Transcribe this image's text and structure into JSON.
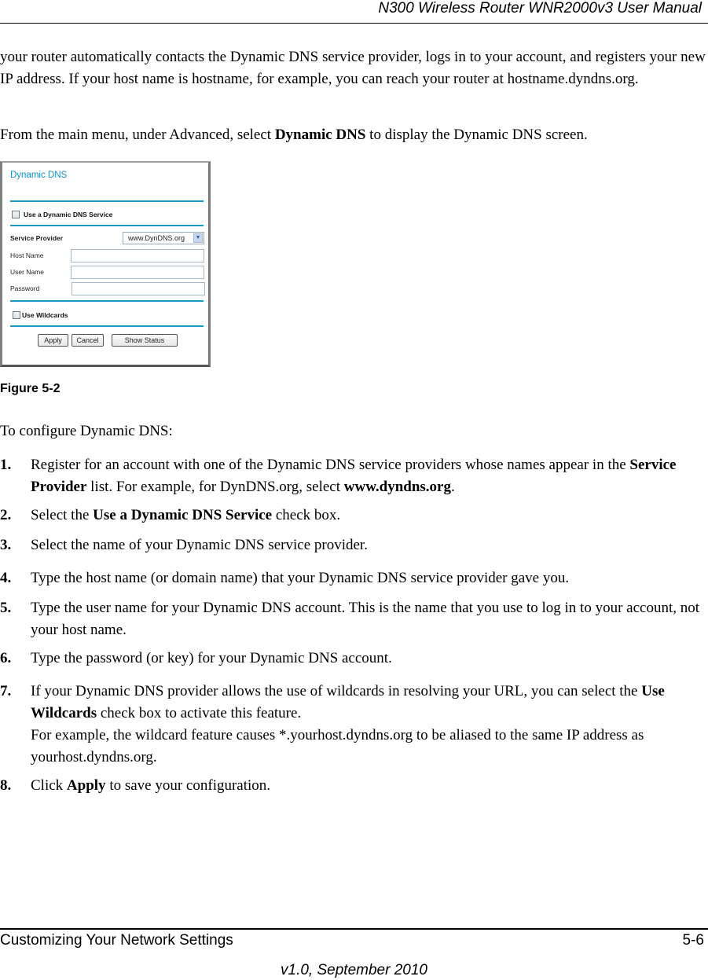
{
  "header": {
    "title": "N300 Wireless Router WNR2000v3 User Manual"
  },
  "body": {
    "paragraph1": "your router automatically contacts the Dynamic DNS service provider, logs in to your account, and registers your new IP address. If your host name is hostname, for example, you can reach your router at hostname.dyndns.org.",
    "paragraph2_pre": "From the main menu, under Advanced, select ",
    "paragraph2_bold": "Dynamic DNS",
    "paragraph2_post": " to display the Dynamic DNS screen.",
    "intro": "To configure Dynamic DNS:"
  },
  "figure": {
    "caption": "Figure 5-2",
    "screen": {
      "title": "Dynamic DNS",
      "use_ddns_label": "Use a Dynamic DNS Service",
      "use_ddns_checked": false,
      "service_provider_label": "Service Provider",
      "service_provider_value": "www.DynDNS.org",
      "host_name_label": "Host Name",
      "host_name_value": "",
      "user_name_label": "User Name",
      "user_name_value": "",
      "password_label": "Password",
      "password_value": "",
      "use_wildcards_label": "Use Wildcards",
      "use_wildcards_checked": false,
      "apply_label": "Apply",
      "cancel_label": "Cancel",
      "show_status_label": "Show Status"
    }
  },
  "steps": [
    {
      "num": "1.",
      "parts": [
        "Register for an account with one of the Dynamic DNS service providers whose names appear in the ",
        "Service Provider",
        " list. For example, for DynDNS.org, select ",
        "www.dyndns.org",
        "."
      ]
    },
    {
      "num": "2.",
      "parts": [
        "Select the ",
        "Use a Dynamic DNS Service",
        " check box."
      ]
    },
    {
      "num": "3.",
      "parts": [
        "Select the name of your Dynamic DNS service provider."
      ]
    },
    {
      "num": "4.",
      "parts": [
        "Type the host name (or domain name) that your Dynamic DNS service provider gave you."
      ]
    },
    {
      "num": "5.",
      "parts": [
        "Type the user name for your Dynamic DNS account. This is the name that you use to log in to your account, not your host name."
      ]
    },
    {
      "num": "6.",
      "parts": [
        "Type the password (or key) for your Dynamic DNS account."
      ]
    },
    {
      "num": "7.",
      "parts": [
        "If your Dynamic DNS provider allows the use of wildcards in resolving your URL, you can select the ",
        "Use Wildcards",
        " check box to activate this feature."
      ],
      "extra": "For example, the wildcard feature causes *.yourhost.dyndns.org to be aliased to the same IP address as yourhost.dyndns.org."
    },
    {
      "num": "8.",
      "parts": [
        "Click ",
        "Apply",
        " to save your configuration."
      ]
    }
  ],
  "footer": {
    "section": "Customizing Your Network Settings",
    "page": "5-6",
    "version": "v1.0, September 2010"
  }
}
